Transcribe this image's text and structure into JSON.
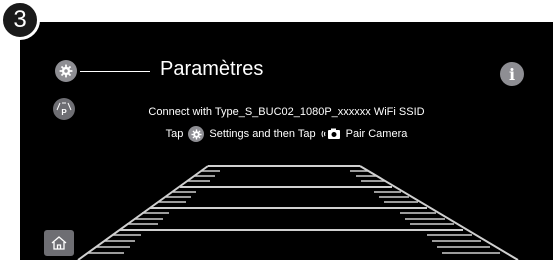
{
  "step": {
    "number": "3"
  },
  "callout": {
    "label": "Paramètres"
  },
  "instructions": {
    "line1": "Connect with Type_S_BUC02_1080P_xxxxxx WiFi SSID",
    "line2_tap": "Tap",
    "line2_settings": "Settings and then Tap",
    "line2_pair": "Pair Camera"
  },
  "buttons": {
    "info_glyph": "i",
    "park_glyph": "P"
  },
  "icons": {
    "settings": "gear-icon",
    "parking": "parking-icon",
    "info": "info-icon",
    "camera": "camera-icon",
    "home": "home-icon"
  },
  "colors": {
    "screen_bg": "#000000",
    "icon_gray": "#8e8e93",
    "text": "#ffffff",
    "guide_lines": "#d0d0d0"
  }
}
